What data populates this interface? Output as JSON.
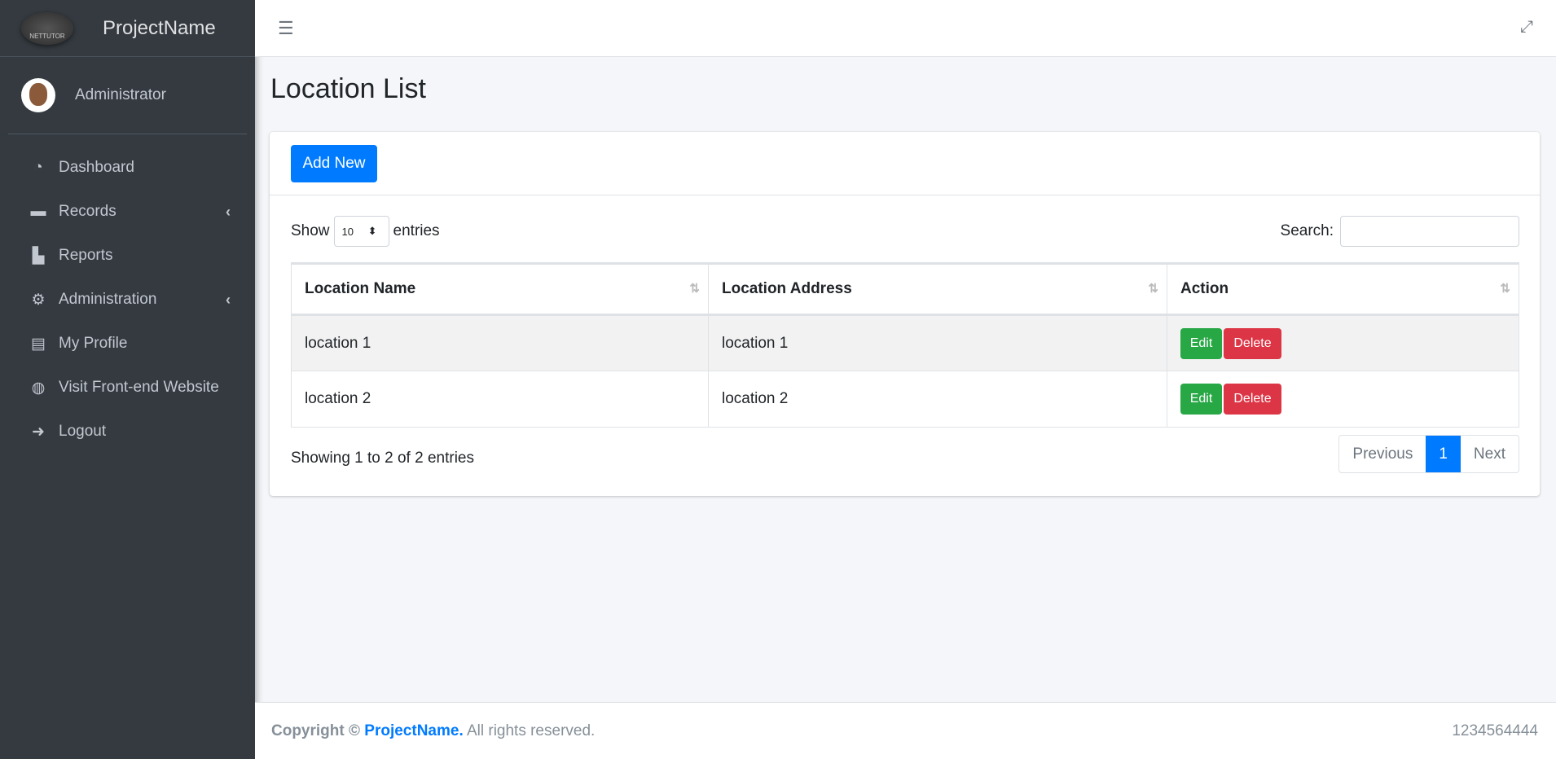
{
  "brand": {
    "name": "ProjectName",
    "logo_text": "NETTUTOR.COM"
  },
  "user": {
    "name": "Administrator"
  },
  "sidebar": {
    "items": [
      {
        "label": "Dashboard",
        "icon": "tachometer-icon"
      },
      {
        "label": "Records",
        "icon": "folder-icon",
        "has_submenu": true
      },
      {
        "label": "Reports",
        "icon": "chart-bar-icon"
      },
      {
        "label": "Administration",
        "icon": "cogs-icon",
        "has_submenu": true
      },
      {
        "label": "My Profile",
        "icon": "id-card-icon"
      },
      {
        "label": "Visit Front-end Website",
        "icon": "globe-icon"
      },
      {
        "label": "Logout",
        "icon": "sign-out-icon"
      }
    ]
  },
  "page": {
    "title": "Location List",
    "add_label": "Add New"
  },
  "table_controls": {
    "show": "Show",
    "entries": "entries",
    "page_length": "10",
    "search_label": "Search:",
    "search_value": ""
  },
  "table": {
    "headers": [
      "Location Name",
      "Location Address",
      "Action"
    ],
    "rows": [
      {
        "name": "location 1",
        "address": "location 1"
      },
      {
        "name": "location 2",
        "address": "location 2"
      }
    ],
    "edit_label": "Edit",
    "delete_label": "Delete"
  },
  "info": "Showing 1 to 2 of 2 entries",
  "pagination": {
    "previous": "Previous",
    "current": "1",
    "next": "Next"
  },
  "footer": {
    "copyright": "Copyright ©",
    "brand": "ProjectName.",
    "rights": "All rights reserved.",
    "phone": "1234564444"
  }
}
